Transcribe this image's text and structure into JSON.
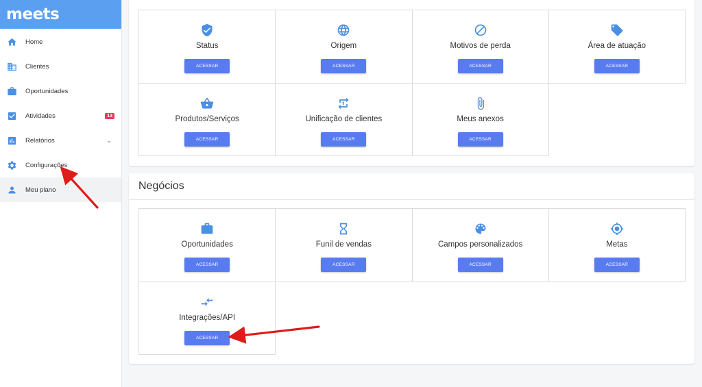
{
  "app": {
    "logo": "meets"
  },
  "sidebar": {
    "items": [
      {
        "label": "Home",
        "icon": "home-icon"
      },
      {
        "label": "Clientes",
        "icon": "building-icon"
      },
      {
        "label": "Oportunidades",
        "icon": "briefcase-icon"
      },
      {
        "label": "Atividades",
        "icon": "checkbox-icon",
        "badge": "13"
      },
      {
        "label": "Relatórios",
        "icon": "bar-chart-icon",
        "chevron": "⌄"
      },
      {
        "label": "Configurações",
        "icon": "gear-icon"
      },
      {
        "label": "Meu plano",
        "icon": "person-icon"
      }
    ]
  },
  "section1": {
    "tiles": [
      {
        "title": "Status",
        "icon": "shield-check-icon",
        "button": "ACESSAR"
      },
      {
        "title": "Origem",
        "icon": "globe-icon",
        "button": "ACESSAR"
      },
      {
        "title": "Motivos de perda",
        "icon": "block-icon",
        "button": "ACESSAR"
      },
      {
        "title": "Área de atuação",
        "icon": "tag-icon",
        "button": "ACESSAR"
      },
      {
        "title": "Produtos/Serviços",
        "icon": "basket-icon",
        "button": "ACESSAR"
      },
      {
        "title": "Unificação de clientes",
        "icon": "repeat-one-icon",
        "button": "ACESSAR"
      },
      {
        "title": "Meus anexos",
        "icon": "paperclip-icon",
        "button": "ACESSAR"
      }
    ]
  },
  "section2": {
    "title": "Negócios",
    "tiles": [
      {
        "title": "Oportunidades",
        "icon": "briefcase-icon",
        "button": "ACESSAR"
      },
      {
        "title": "Funil de vendas",
        "icon": "hourglass-icon",
        "button": "ACESSAR"
      },
      {
        "title": "Campos personalizados",
        "icon": "palette-icon",
        "button": "ACESSAR"
      },
      {
        "title": "Metas",
        "icon": "target-icon",
        "button": "ACESSAR"
      },
      {
        "title": "Integrações/API",
        "icon": "compare-arrows-icon",
        "button": "ACESSAR"
      }
    ]
  },
  "colors": {
    "brand": "#5b9ff0",
    "icon": "#4a90e2",
    "button": "#587cf0",
    "badge": "#e5395f",
    "annotation_arrow": "#e01b1b"
  }
}
